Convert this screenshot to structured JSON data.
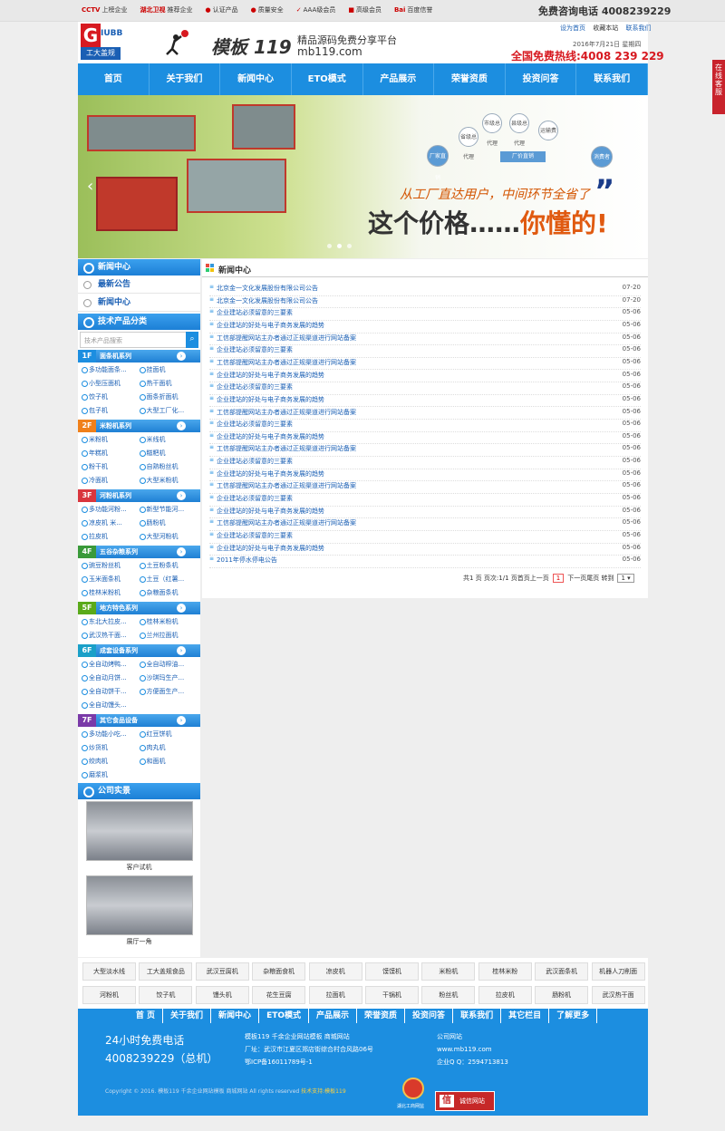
{
  "topbar": {
    "badges": [
      {
        "mark": "CCTV",
        "label": "上榜企业"
      },
      {
        "mark": "湖北卫视",
        "label": "推荐企业"
      },
      {
        "mark": "●",
        "label": "认证产品"
      },
      {
        "mark": "●",
        "label": "质量安全"
      },
      {
        "mark": "✓",
        "label": "AAA级会员"
      },
      {
        "mark": "■",
        "label": "高级会员"
      },
      {
        "mark": "Bai",
        "label": "百度信誉"
      }
    ],
    "hotline_label": "免费咨询电话",
    "hotline_number": "4008239229"
  },
  "header": {
    "logo_letter": "G",
    "logo_right": "IUBB",
    "logo_sub": "工大盖规",
    "brand": "模板 119",
    "slogan": "精品源码免费分享平台",
    "domain": "mb119.com",
    "links": [
      "设为首页",
      "收藏本站",
      "联系我们"
    ],
    "date": "2016年7月21日 星期四",
    "hotline": "全国免费热线:4008 239 229"
  },
  "nav": [
    "首页",
    "关于我们",
    "新闻中心",
    "ETO模式",
    "产品展示",
    "荣誉资质",
    "投资问答",
    "联系我们"
  ],
  "banner": {
    "line1": "从工厂直达用户，中间环节全省了",
    "line2_a": "这个价格……",
    "line2_b": "你懂的!",
    "quote": "”",
    "flow": [
      "厂家直销",
      "省级总代理",
      "市级总代理",
      "县级总代理",
      "运输费",
      "消费者",
      "厂价直销"
    ]
  },
  "sidebar": {
    "news_head": "新闻中心",
    "sub1": "最新公告",
    "sub2": "新闻中心",
    "cat_head": "技术产品分类",
    "search_placeholder": "技术产品搜索",
    "floors": [
      {
        "num": "1F",
        "title": "面条机系列",
        "color": "#1c8ee0",
        "items": [
          "多功能面条...",
          "挂面机",
          "小型压面机",
          "热干面机",
          "饺子机",
          "面条折面机",
          "包子机",
          "大型工厂化..."
        ]
      },
      {
        "num": "2F",
        "title": "米粉机系列",
        "color": "#f0801a",
        "items": [
          "米粉机",
          "米线机",
          "年糕机",
          "糍粑机",
          "粉干机",
          "自熟粉丝机",
          "冷面机",
          "大型米粉机"
        ]
      },
      {
        "num": "3F",
        "title": "河粉机系列",
        "color": "#d9363e",
        "items": [
          "多功能河粉...",
          "新型节能河...",
          "凉皮机 米...",
          "肠粉机",
          "拉皮机",
          "大型河粉机"
        ]
      },
      {
        "num": "4F",
        "title": "五谷杂粮系列",
        "color": "#3a9a3a",
        "items": [
          "豌豆粉丝机",
          "土豆粉条机",
          "玉米面条机",
          "土豆（红薯...",
          "桂林米粉机",
          "杂粮面条机"
        ]
      },
      {
        "num": "5F",
        "title": "地方特色系列",
        "color": "#5aaa1a",
        "items": [
          "东北大拉皮...",
          "桂林米粉机",
          "武汉热干面...",
          "兰州拉面机"
        ]
      },
      {
        "num": "6F",
        "title": "成套设备系列",
        "color": "#1aa0c8",
        "items": [
          "全自动烤鸭...",
          "全自动榨油...",
          "全自动月饼...",
          "沙琪玛生产...",
          "全自动饼干...",
          "方便面生产...",
          "全自动馒头..."
        ]
      },
      {
        "num": "7F",
        "title": "其它食品设备",
        "color": "#7a3aa8",
        "items": [
          "多功能小吃...",
          "红豆饼机",
          "炒货机",
          "肉丸机",
          "绞肉机",
          "和面机",
          "磨浆机"
        ]
      }
    ],
    "photo_head": "公司实景",
    "photos": [
      "客户试机",
      "展厅一角"
    ]
  },
  "main": {
    "title": "新闻中心",
    "news": [
      {
        "title": "北京金一文化发展股份有限公司公告",
        "date": "07-20"
      },
      {
        "title": "北京金一文化发展股份有限公司公告",
        "date": "07-20"
      },
      {
        "title": "企业建站必须留意的三要素",
        "date": "05-06"
      },
      {
        "title": "企业建站的好处与电子商务发展的趋势",
        "date": "05-06"
      },
      {
        "title": "工信部提醒网站主办者通过正规渠道进行网站备案",
        "date": "05-06"
      },
      {
        "title": "企业建站必须留意的三要素",
        "date": "05-06"
      },
      {
        "title": "工信部提醒网站主办者通过正规渠道进行网站备案",
        "date": "05-06"
      },
      {
        "title": "企业建站的好处与电子商务发展的趋势",
        "date": "05-06"
      },
      {
        "title": "企业建站必须留意的三要素",
        "date": "05-06"
      },
      {
        "title": "企业建站的好处与电子商务发展的趋势",
        "date": "05-06"
      },
      {
        "title": "工信部提醒网站主办者通过正规渠道进行网站备案",
        "date": "05-06"
      },
      {
        "title": "企业建站必须留意的三要素",
        "date": "05-06"
      },
      {
        "title": "企业建站的好处与电子商务发展的趋势",
        "date": "05-06"
      },
      {
        "title": "工信部提醒网站主办者通过正规渠道进行网站备案",
        "date": "05-06"
      },
      {
        "title": "企业建站必须留意的三要素",
        "date": "05-06"
      },
      {
        "title": "企业建站的好处与电子商务发展的趋势",
        "date": "05-06"
      },
      {
        "title": "工信部提醒网站主办者通过正规渠道进行网站备案",
        "date": "05-06"
      },
      {
        "title": "企业建站必须留意的三要素",
        "date": "05-06"
      },
      {
        "title": "企业建站的好处与电子商务发展的趋势",
        "date": "05-06"
      },
      {
        "title": "工信部提醒网站主办者通过正规渠道进行网站备案",
        "date": "05-06"
      },
      {
        "title": "企业建站必须留意的三要素",
        "date": "05-06"
      },
      {
        "title": "企业建站的好处与电子商务发展的趋势",
        "date": "05-06"
      },
      {
        "title": "2011年停水停电公告",
        "date": "05-06"
      }
    ],
    "pager": {
      "prefix": "共1 页 页次:1/1 页首页上一页",
      "current": "1",
      "suffix": "下一页尾页 转到",
      "select": "1 ▾"
    }
  },
  "tags": [
    "大型淡水线",
    "工大盖规食品",
    "武汉豆腐机",
    "杂粮面食机",
    "凉皮机",
    "馍馍机",
    "米粉机",
    "桂林米粉",
    "武汉面条机",
    "机器人刀削面",
    "河粉机",
    "饺子机",
    "馒头机",
    "花生豆腐",
    "拉面机",
    "干锅机",
    "粉丝机",
    "拉皮机",
    "肠粉机",
    "武汉热干面"
  ],
  "footer_nav": [
    "首 页",
    "关于我们",
    "新闻中心",
    "ETO模式",
    "产品展示",
    "荣誉资质",
    "投资问答",
    "联系我们",
    "其它栏目",
    "了解更多"
  ],
  "footer": {
    "h24": "24小时免费电话",
    "tel": "4008239229（总机）",
    "col1": [
      "模板119 千余企业网站模板 商城网站",
      "厂址：武汉市江夏区郑店街综合村合风路06号",
      "鄂ICP备16011789号-1"
    ],
    "col2": [
      "公司网站",
      "www.mb119.com",
      "企业Q Q：2594713813"
    ],
    "copy": "Copyright © 2016. 模板119 千余企业网站模板 商城网站 All rights reserved",
    "copy_link": "技术支持:模板119",
    "seal_cap": "湖北工商网监",
    "cred": "诚信网站",
    "cred_icon": "信"
  },
  "kefu": "在线客服"
}
